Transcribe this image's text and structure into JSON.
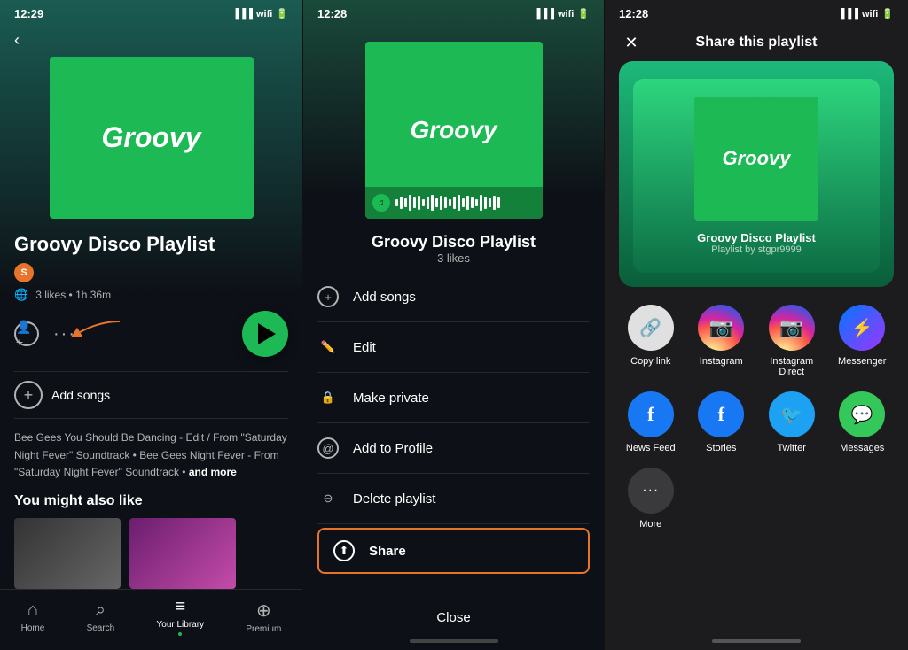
{
  "panel1": {
    "status_time": "12:29",
    "back_label": "‹",
    "album_title": "Groovy",
    "playlist_name": "Groovy Disco Playlist",
    "creator_initial": "S",
    "meta": "3 likes • 1h 36m",
    "add_songs": "Add songs",
    "songs_preview": "Bee Gees You Should Be Dancing - Edit / From \"Saturday Night Fever\" Soundtrack • Bee Gees Night Fever - From \"Saturday Night Fever\" Soundtrack •",
    "and_more": "and more",
    "you_might_like": "You might also like",
    "nav": {
      "home": "Home",
      "search": "Search",
      "library": "Your Library",
      "premium": "Premium"
    }
  },
  "panel2": {
    "status_time": "12:28",
    "album_title": "Groovy",
    "playlist_name": "Groovy Disco Playlist",
    "likes": "3 likes",
    "menu_items": [
      {
        "id": "add-songs",
        "label": "Add songs",
        "icon": "+"
      },
      {
        "id": "edit",
        "label": "Edit",
        "icon": "✏"
      },
      {
        "id": "make-private",
        "label": "Make private",
        "icon": "🔒"
      },
      {
        "id": "add-to-profile",
        "label": "Add to Profile",
        "icon": "👤"
      },
      {
        "id": "delete-playlist",
        "label": "Delete playlist",
        "icon": "⊖"
      },
      {
        "id": "share",
        "label": "Share",
        "icon": "⬆"
      }
    ],
    "close_label": "Close"
  },
  "panel3": {
    "status_time": "12:28",
    "share_title": "Share this playlist",
    "album_title": "Groovy",
    "playlist_name": "Groovy Disco Playlist",
    "playlist_by": "Playlist by stgpr9999",
    "share_options": [
      {
        "id": "copy-link",
        "label": "Copy link",
        "icon_class": "icon-link",
        "icon": "🔗"
      },
      {
        "id": "instagram",
        "label": "Instagram",
        "icon_class": "icon-insta",
        "icon": "📷"
      },
      {
        "id": "instagram-direct",
        "label": "Instagram Direct",
        "icon_class": "icon-insta-direct",
        "icon": "📷"
      },
      {
        "id": "messenger",
        "label": "Messenger",
        "icon_class": "icon-messenger",
        "icon": "⚡"
      },
      {
        "id": "news-feed",
        "label": "News Feed",
        "icon_class": "icon-facebook",
        "icon": "f"
      },
      {
        "id": "stories",
        "label": "Stories",
        "icon_class": "icon-stories",
        "icon": "f"
      },
      {
        "id": "twitter",
        "label": "Twitter",
        "icon_class": "icon-twitter",
        "icon": "🐦"
      },
      {
        "id": "messages",
        "label": "Messages",
        "icon_class": "icon-messages",
        "icon": "💬"
      },
      {
        "id": "more",
        "label": "More",
        "icon_class": "icon-more",
        "icon": "···"
      }
    ]
  }
}
